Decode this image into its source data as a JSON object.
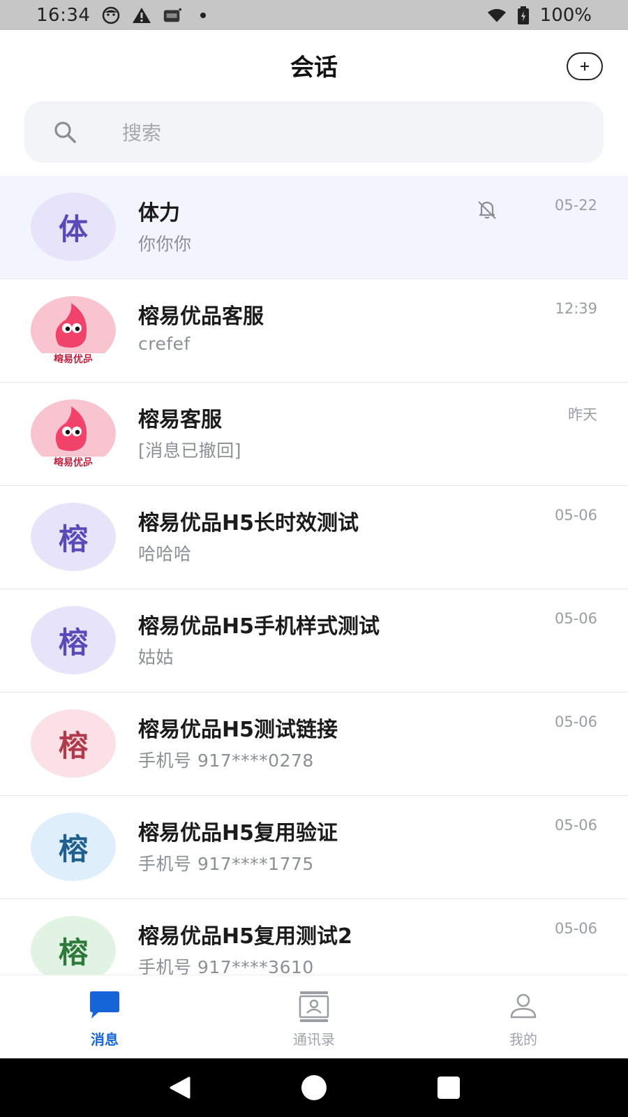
{
  "status_bar": {
    "time": "16:34",
    "battery": "100%"
  },
  "header": {
    "title": "会话",
    "add_icon": "plus-circle-icon"
  },
  "search": {
    "placeholder": "搜索",
    "icon": "search-icon"
  },
  "conversations": [
    {
      "avatar_text": "体",
      "avatar_bg": "#e7e4fa",
      "avatar_fg": "#5a4ab8",
      "name": "体力",
      "preview": "你你你",
      "time": "05-22",
      "muted": true,
      "pinned": true
    },
    {
      "avatar_text": "",
      "avatar_image": "rongyi-logo",
      "avatar_caption": "榕易优品",
      "name": "榕易优品客服",
      "preview": "crefef",
      "time": "12:39"
    },
    {
      "avatar_text": "",
      "avatar_image": "rongyi-logo",
      "avatar_caption": "榕易优品",
      "name": "榕易客服",
      "preview": "[消息已撤回]",
      "time": "昨天"
    },
    {
      "avatar_text": "榕",
      "avatar_bg": "#e7e4fa",
      "avatar_fg": "#5a4ab8",
      "name": "榕易优品H5长时效测试",
      "preview": "哈哈哈",
      "time": "05-06"
    },
    {
      "avatar_text": "榕",
      "avatar_bg": "#e7e4fa",
      "avatar_fg": "#5a4ab8",
      "name": "榕易优品H5手机样式测试",
      "preview": "姑姑",
      "time": "05-06"
    },
    {
      "avatar_text": "榕",
      "avatar_bg": "#fbe1e5",
      "avatar_fg": "#b03a4c",
      "name": "榕易优品H5测试链接",
      "preview": "手机号 917****0278",
      "time": "05-06"
    },
    {
      "avatar_text": "榕",
      "avatar_bg": "#dfeefb",
      "avatar_fg": "#1e5f8e",
      "name": "榕易优品H5复用验证",
      "preview": "手机号 917****1775",
      "time": "05-06"
    },
    {
      "avatar_text": "榕",
      "avatar_bg": "#e1f3e2",
      "avatar_fg": "#2e7a3a",
      "name": "榕易优品H5复用测试2",
      "preview": "手机号 917****3610",
      "time": "05-06"
    }
  ],
  "tabs": [
    {
      "label": "消息",
      "icon": "chat-bubble-icon",
      "active": true
    },
    {
      "label": "通讯录",
      "icon": "contacts-icon",
      "active": false
    },
    {
      "label": "我的",
      "icon": "person-icon",
      "active": false
    }
  ],
  "colors": {
    "accent": "#1565d8",
    "pinned_bg": "#f2f5fd"
  }
}
